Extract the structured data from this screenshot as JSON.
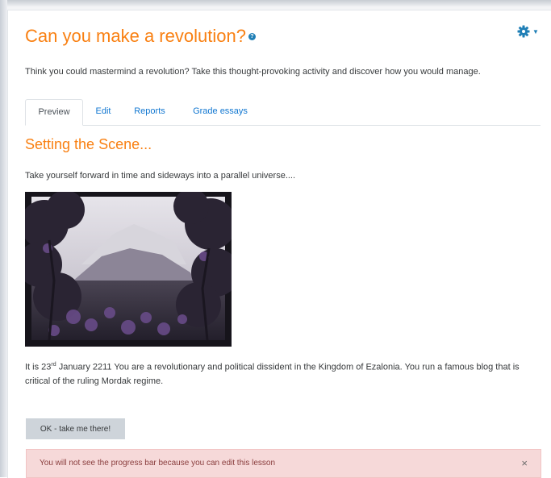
{
  "page": {
    "title": "Can you make a revolution?",
    "intro": "Think you could mastermind a revolution? Take this thought-provoking activity and discover how you would manage."
  },
  "tabs": [
    {
      "label": "Preview",
      "active": true
    },
    {
      "label": "Edit",
      "active": false
    },
    {
      "label": "Reports",
      "active": false
    },
    {
      "label": "Grade essays",
      "active": false
    }
  ],
  "content": {
    "section_title": "Setting the Scene...",
    "lead": "Take yourself forward in time and sideways into a parallel universe....",
    "para_before_sup": "It is 23",
    "para_sup": "rd",
    "para_after_sup": " January 2211 You are a revolutionary and political dissident in  the Kingdom of Ezalonia. You run a famous blog that is critical of the ruling Mordak regime.",
    "button_label": "OK - take me there!"
  },
  "alert": {
    "text": "You will not see the progress bar because you can edit this lesson",
    "close": "×"
  },
  "colors": {
    "accent_orange": "#f98012",
    "link_blue": "#1177d1",
    "icon_blue": "#1f7fb6",
    "alert_bg": "#f6d9d9",
    "button_bg": "#ced4da"
  },
  "icons": {
    "help": "help-icon",
    "settings": "gear-icon",
    "settings_menu": "caret-down-icon",
    "close": "close-icon"
  }
}
